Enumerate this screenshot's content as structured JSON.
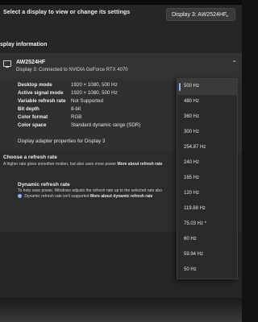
{
  "header": {
    "select_label": "Select a display to view or change its settings",
    "display_select_value": "Display 3: AW2524HF"
  },
  "display_info": {
    "heading": "splay information",
    "monitor_name": "AW2524HF",
    "monitor_sub": "Display 3: Connected to NVIDIA GeForce RTX 4070",
    "rows": [
      {
        "key": "Desktop mode",
        "value": "1920 × 1080, 500 Hz"
      },
      {
        "key": "Active signal mode",
        "value": "1920 × 1080, 500 Hz"
      },
      {
        "key": "Variable refresh rate",
        "value": "Not Supported"
      },
      {
        "key": "Bit depth",
        "value": "8-bit"
      },
      {
        "key": "Color format",
        "value": "RGB"
      },
      {
        "key": "Color space",
        "value": "Standard dynamic range (SDR)"
      }
    ],
    "adapter_link": "Display adapter properties for Display 3"
  },
  "refresh": {
    "title": "Choose a refresh rate",
    "desc": "A higher rate gives smoother motion, but also uses more power",
    "desc_link": "More about refresh rate",
    "dyn_title": "Dynamic refresh rate",
    "dyn_desc": "To help save power, Windows adjusts the refresh rate up to the selected rate abo",
    "dyn_note": "Dynamic refresh rate isn't supported",
    "dyn_link": "More about dynamic refresh rate"
  },
  "dropdown": {
    "options": [
      "500 Hz",
      "480 Hz",
      "360 Hz",
      "300 Hz",
      "254.87 Hz",
      "240 Hz",
      "165 Hz",
      "120 Hz",
      "119.88 Hz",
      "75.03 Hz *",
      "60 Hz",
      "59.94 Hz",
      "50 Hz"
    ],
    "selected_index": 0
  },
  "colors": {
    "accent": "#8ab4f8",
    "background": "#262626"
  },
  "icons": {
    "monitor": "monitor-icon",
    "chevron_up": "chevron-up-icon",
    "chevron_down": "chevron-down-icon",
    "info": "info-icon"
  }
}
